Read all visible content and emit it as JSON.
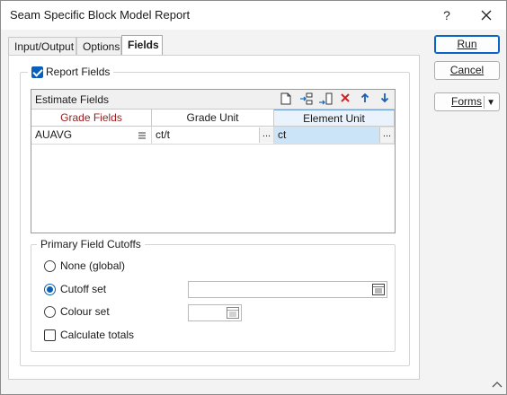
{
  "window": {
    "title": "Seam Specific Block Model Report",
    "help_label": "?",
    "close_label": "✕"
  },
  "tabs": [
    {
      "label": "Input/Output"
    },
    {
      "label": "Options"
    },
    {
      "label": "Fields",
      "active": true
    }
  ],
  "report_fields": {
    "label": "Report Fields",
    "checked": true
  },
  "estimate_fields": {
    "title": "Estimate Fields",
    "toolbar_icons": [
      "new-icon",
      "insert-row-icon",
      "append-row-icon",
      "delete-icon",
      "move-up-icon",
      "move-down-icon"
    ],
    "columns": [
      "Grade Fields",
      "Grade Unit",
      "Element Unit"
    ],
    "rows": [
      {
        "grade_field": "AUAVG",
        "grade_unit": "ct/t",
        "element_unit": "ct"
      }
    ],
    "ellipsis": "..."
  },
  "primary_field_cutoffs": {
    "label": "Primary Field Cutoffs",
    "options": [
      {
        "label": "None (global)",
        "selected": false
      },
      {
        "label": "Cutoff set",
        "selected": true,
        "value": ""
      },
      {
        "label": "Colour set",
        "selected": false,
        "value": ""
      }
    ],
    "calculate_totals": {
      "label": "Calculate totals",
      "checked": false
    }
  },
  "buttons": {
    "run": "Run",
    "cancel": "Cancel",
    "forms": "Forms"
  },
  "colors": {
    "accent": "#0a5fb8",
    "grade_header_text": "#9b1b1b",
    "selected_cell": "#cce4f7"
  }
}
